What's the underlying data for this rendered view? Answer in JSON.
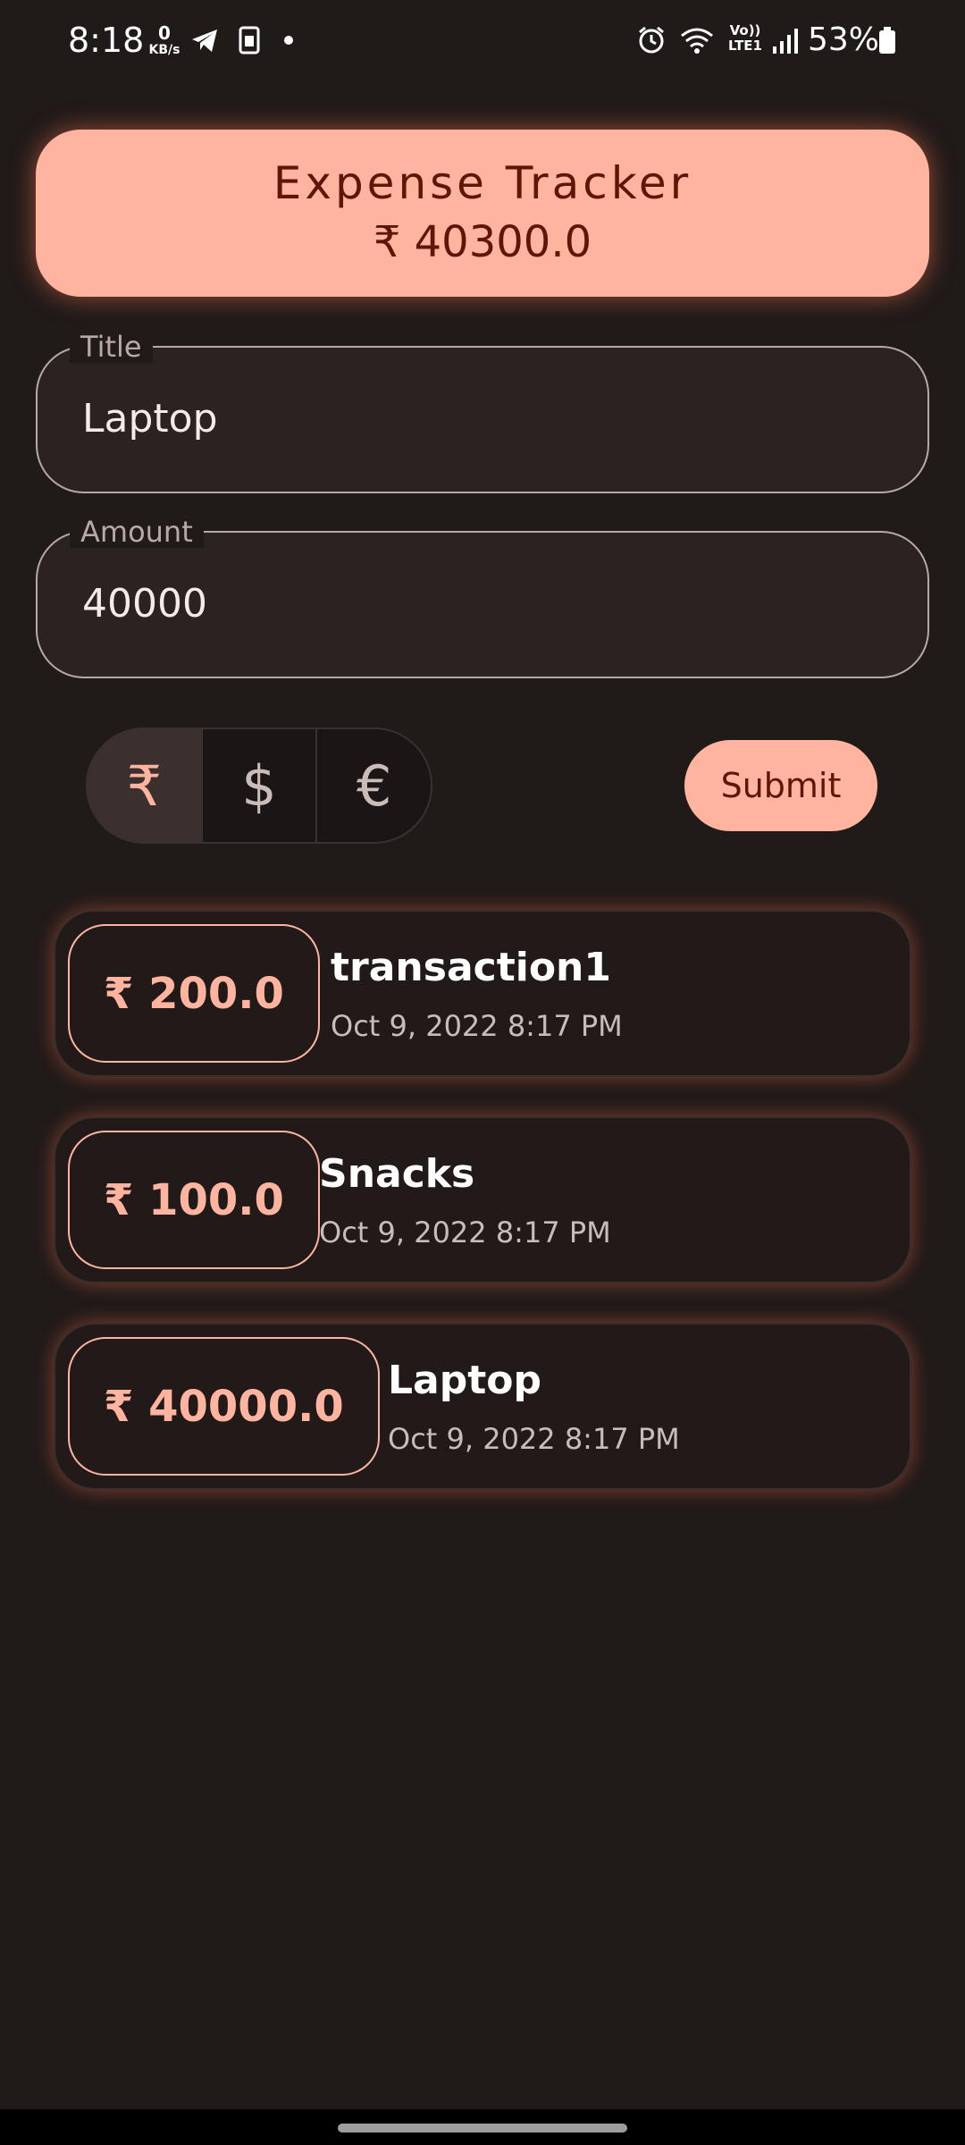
{
  "status_bar": {
    "time": "8:18",
    "net_speed_value": "0",
    "net_speed_unit": "KB/s",
    "network_label": "Vo))\nLTE1",
    "battery": "53%",
    "icons": [
      "telegram-icon",
      "sim-icon",
      "alarm-icon",
      "wifi-icon",
      "signal-icon",
      "battery-icon"
    ]
  },
  "header": {
    "title": "Expense Tracker",
    "total": "₹ 40300.0"
  },
  "form": {
    "title_label": "Title",
    "title_value": "Laptop",
    "amount_label": "Amount",
    "amount_value": "40000",
    "currencies": [
      "₹",
      "$",
      "€"
    ],
    "selected_currency": "₹",
    "submit_label": "Submit"
  },
  "transactions": [
    {
      "amount": "₹ 200.0",
      "title": "transaction1",
      "date": "Oct 9, 2022   8:17 PM"
    },
    {
      "amount": "₹ 100.0",
      "title": "Snacks",
      "date": "Oct 9, 2022   8:17 PM"
    },
    {
      "amount": "₹ 40000.0",
      "title": "Laptop",
      "date": "Oct 9, 2022   8:17 PM"
    }
  ],
  "colors": {
    "background": "#201a19",
    "accent": "#ffb4a0",
    "on_accent": "#5f1607"
  }
}
